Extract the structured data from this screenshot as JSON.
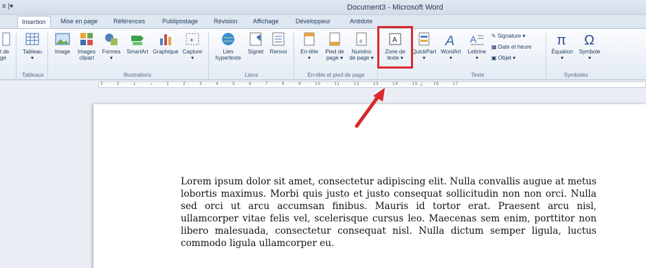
{
  "window": {
    "title": "Document3 - Microsoft Word",
    "qat": "≡ |▾"
  },
  "tabs": [
    "Insertion",
    "Mise en page",
    "Références",
    "Publipostage",
    "Révision",
    "Affichage",
    "Développeur",
    "Antidote"
  ],
  "active_tab": "Insertion",
  "ribbon": {
    "cut_left": "t de\nge",
    "tableau": "Tableau",
    "image": "Image",
    "images_clipart": "Images\nclipart",
    "formes": "Formes",
    "smartart": "SmartArt",
    "graphique": "Graphique",
    "capture": "Capture",
    "lien": "Lien\nhypertexte",
    "signet": "Signet",
    "renvoi": "Renvoi",
    "entete": "En-tête",
    "pied": "Pied de\npage ▾",
    "numero": "Numéro\nde page ▾",
    "zone": "Zone de\ntexte ▾",
    "quickpart": "QuickPart",
    "wordart": "WordArt",
    "lettrine": "Lettrine",
    "signature": "Signature ▾",
    "date_heure": "Date et heure",
    "objet": "Objet ▾",
    "equation": "Équation",
    "symbole": "Symbole",
    "groups": {
      "tableaux": "Tableaux",
      "illustrations": "Illustrations",
      "liens": "Liens",
      "entete_pied": "En-tête et pied de page",
      "texte": "Texte",
      "symboles": "Symboles"
    }
  },
  "ruler": "3 · · · 2 · · · 1 · · · ⌂ · · · 1 · · · 2 · · · 3 · · · 4 · · · 5 · · · 6 · · · 7 · · · 8 · · · 9 · · · 10 · · · 11 · · · 12 · · · 13 · · · 14 · · · 15 △ · · 16 · · · 17",
  "document": {
    "text": "Lorem ipsum dolor sit amet, consectetur adipiscing elit. Nulla convallis augue at metus lobortis maximus. Morbi quis justo et justo consequat sollicitudin non non orci. Nulla sed orci ut arcu accumsan finibus. Mauris id tortor erat. Praesent arcu nisl, ullamcorper vitae felis vel, scelerisque cursus leo. Maecenas sem enim, porttitor non libero malesuada, consectetur consequat nisl. Nulla dictum semper ligula, luctus commodo ligula ullamcorper eu."
  },
  "colors": {
    "highlight": "#d9292e",
    "accent": "#1e395b"
  }
}
